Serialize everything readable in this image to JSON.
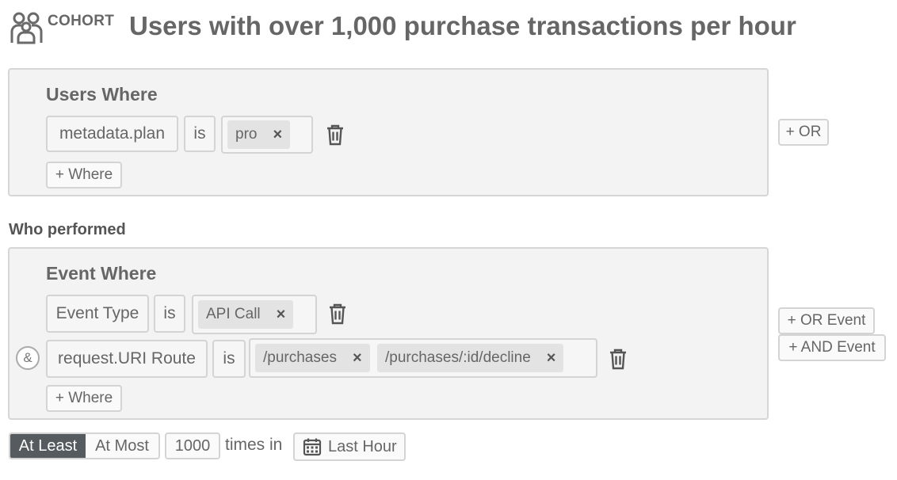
{
  "header": {
    "cohort_label": "COHORT",
    "title": "Users with over 1,000 purchase transactions per hour"
  },
  "users_where": {
    "title": "Users Where",
    "filter": {
      "property": "metadata.plan",
      "operator": "is",
      "values": [
        "pro"
      ]
    },
    "add_where_label": "+ Where",
    "or_label": "+ OR"
  },
  "who_performed_label": "Who performed",
  "event_where": {
    "title": "Event Where",
    "filters": [
      {
        "property": "Event Type",
        "operator": "is",
        "values": [
          "API Call"
        ]
      },
      {
        "property": "request.URI Route",
        "operator": "is",
        "values": [
          "/purchases",
          "/purchases/:id/decline"
        ]
      }
    ],
    "conjunction_symbol": "&",
    "add_where_label": "+ Where",
    "or_event_label": "+ OR Event",
    "and_event_label": "+ AND Event"
  },
  "frequency": {
    "options": [
      "At Least",
      "At Most"
    ],
    "selected": "At Least",
    "count": "1000",
    "times_in_label": "times in",
    "range_label": "Last Hour"
  },
  "icons": {
    "cohort": "users-group-icon",
    "remove": "close-icon",
    "delete": "trash-icon",
    "calendar": "calendar-icon"
  }
}
